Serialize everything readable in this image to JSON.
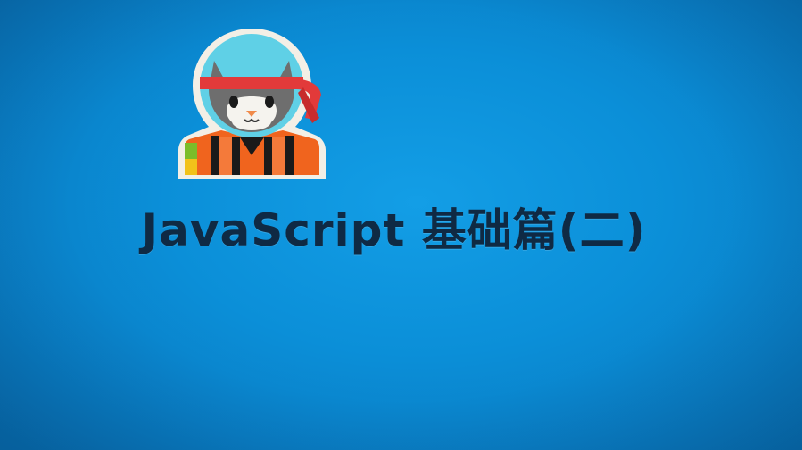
{
  "slide": {
    "title": "JavaScript 基础篇(二)",
    "logo_icon": "ninja-cat-icon"
  },
  "colors": {
    "background": "#0b8fd8",
    "title_text": "#0f2a44",
    "headband": "#e23a3a",
    "cat_fur": "#6e6e6e",
    "helmet_sky": "#5fd0e6",
    "outline": "#f3efe6"
  }
}
